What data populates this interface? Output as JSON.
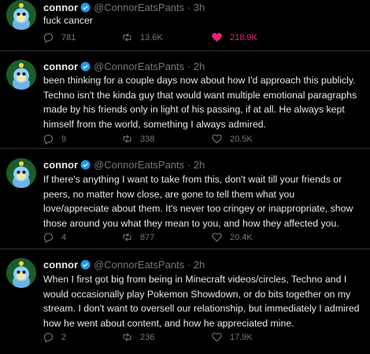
{
  "tweets": [
    {
      "name": "connor",
      "handle": "@ConnorEatsPants",
      "time": "3h",
      "text": "fuck cancer",
      "replies": "781",
      "retweets": "13.6K",
      "likes": "218.9K",
      "liked": true
    },
    {
      "name": "connor",
      "handle": "@ConnorEatsPants",
      "time": "2h",
      "text": "been thinking for a couple days now about how I'd approach this publicly. Techno isn't the kinda guy that would want multiple emotional paragraphs made by his friends only in light of his passing, if at all. He always kept himself from the world, something I always admired.",
      "replies": "9",
      "retweets": "338",
      "likes": "20.5K",
      "liked": false
    },
    {
      "name": "connor",
      "handle": "@ConnorEatsPants",
      "time": "2h",
      "text": "If there's anything I want to take from this, don't wait till your friends or peers, no matter how close, are gone to tell them what you love/appreciate about them. It's never too cringey or inappropriate, show those around you what they mean to you, and how they affected you.",
      "replies": "4",
      "retweets": "877",
      "likes": "20.4K",
      "liked": false
    },
    {
      "name": "connor",
      "handle": "@ConnorEatsPants",
      "time": "2h",
      "text": "When I first got big from being in Minecraft videos/circles, Techno and I would occasionally play Pokemon Showdown, or do bits together on my stream. I don't want to oversell our relationship, but immediately I admired how he went about content, and how he appreciated mine.",
      "replies": "2",
      "retweets": "236",
      "likes": "17.9K",
      "liked": false
    }
  ],
  "colors": {
    "background": "#000000",
    "text": "#e7e9ea",
    "muted": "#71767b",
    "like": "#f91880",
    "verified": "#1d9bf0",
    "divider": "#2f3336"
  },
  "icons": {
    "avatar": "chao-avatar",
    "verified": "verified-badge-icon",
    "reply": "reply-icon",
    "retweet": "retweet-icon",
    "like": "heart-icon"
  }
}
